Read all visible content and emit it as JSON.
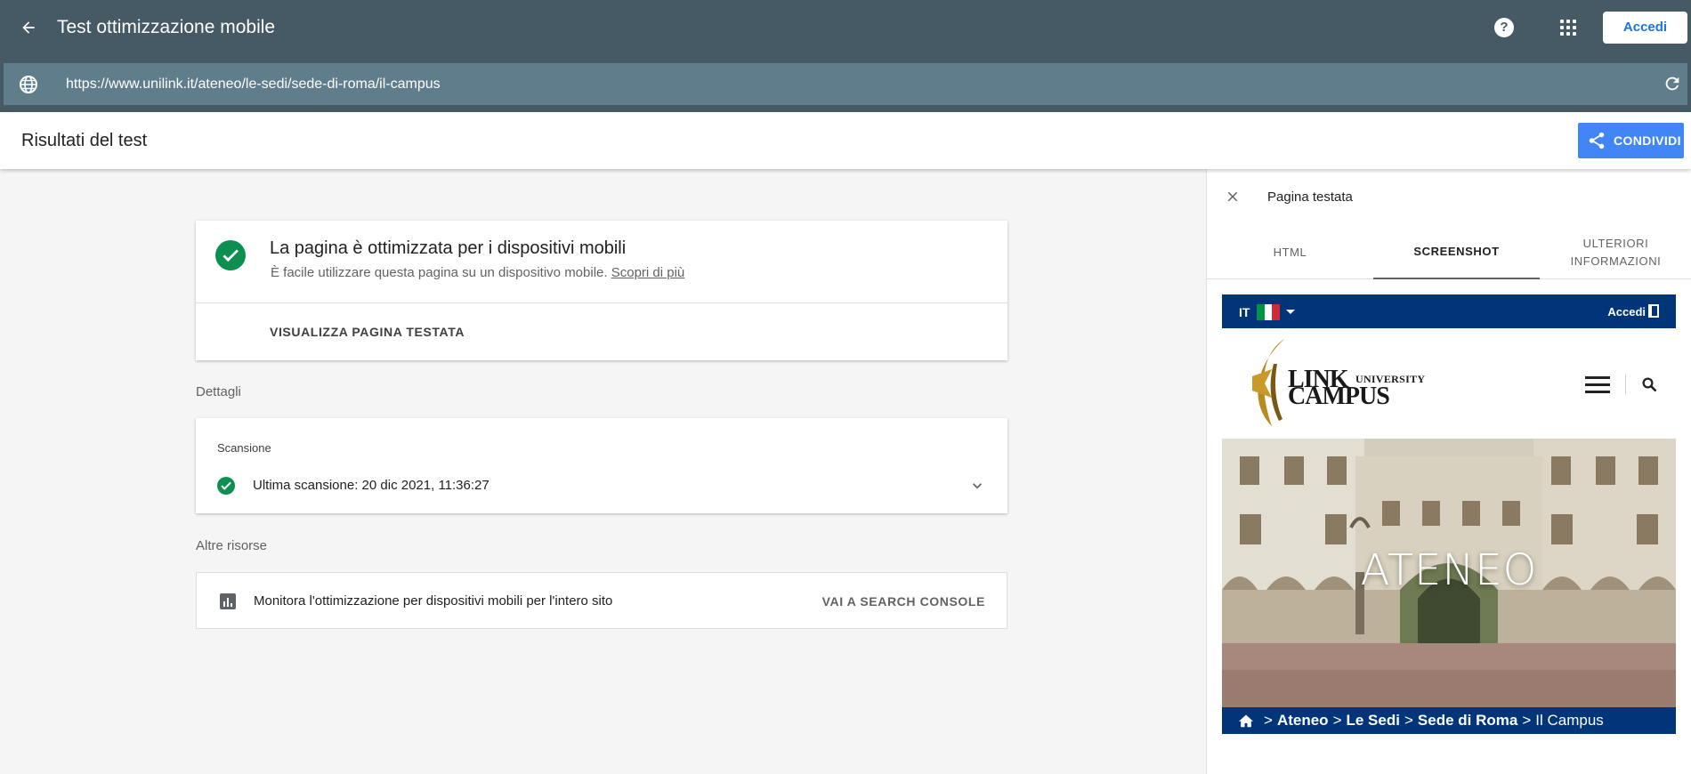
{
  "app": {
    "title": "Test ottimizzazione mobile",
    "signin_label": "Accedi",
    "help_glyph": "?"
  },
  "urlbar": {
    "url": "https://www.unilink.it/ateneo/le-sedi/sede-di-roma/il-campus"
  },
  "results": {
    "title": "Risultati del test",
    "share_label": "CONDIVIDI"
  },
  "result_card": {
    "headline": "La pagina è ottimizzata per i dispositivi mobili",
    "subtext": "È facile utilizzare questa pagina su un dispositivo mobile.",
    "learn_more": "Scopri di più",
    "view_button": "VISUALIZZA PAGINA TESTATA"
  },
  "details": {
    "section_label": "Dettagli",
    "scan_label": "Scansione",
    "scan_text": "Ultima scansione: 20 dic 2021, 11:36:27"
  },
  "resources": {
    "section_label": "Altre risorse",
    "text": "Monitora l'ottimizzazione per dispositivi mobili per l'intero sito",
    "link": "VAI A SEARCH CONSOLE"
  },
  "panel": {
    "title": "Pagina testata",
    "tabs": [
      {
        "label": "HTML",
        "active": false
      },
      {
        "label": "SCREENSHOT",
        "active": true
      },
      {
        "label": "ULTERIORI INFORMAZIONI",
        "active": false
      }
    ]
  },
  "preview": {
    "lang": "IT",
    "signin": "Accedi",
    "logo_line1": "LINK",
    "logo_line2": "CAMPUS",
    "logo_small": "UNIVERSITY",
    "hero_title": "ATENEO",
    "breadcrumb": [
      "Ateneo",
      "Le Sedi",
      "Sede di Roma",
      "Il Campus"
    ],
    "breadcrumb_sep": ">"
  },
  "colors": {
    "appbar": "#455a64",
    "urlbar": "#607d8b",
    "accent_blue": "#4285f4",
    "success_green": "#0d904f",
    "preview_navy": "#00357a"
  }
}
